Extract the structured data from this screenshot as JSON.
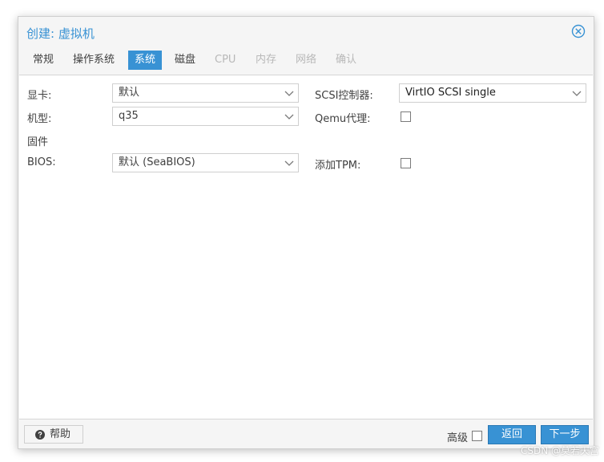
{
  "dialog": {
    "title": "创建: 虚拟机"
  },
  "tabs": [
    {
      "label": "常规",
      "state": "normal"
    },
    {
      "label": "操作系统",
      "state": "normal"
    },
    {
      "label": "系统",
      "state": "active"
    },
    {
      "label": "磁盘",
      "state": "normal"
    },
    {
      "label": "CPU",
      "state": "disabled"
    },
    {
      "label": "内存",
      "state": "disabled"
    },
    {
      "label": "网络",
      "state": "disabled"
    },
    {
      "label": "确认",
      "state": "disabled"
    }
  ],
  "form": {
    "graphics": {
      "label": "显卡:",
      "value": "默认"
    },
    "machine": {
      "label": "机型:",
      "value": "q35"
    },
    "firmware_heading": "固件",
    "bios": {
      "label": "BIOS:",
      "value": "默认 (SeaBIOS)"
    },
    "scsi": {
      "label": "SCSI控制器:",
      "value": "VirtIO SCSI single"
    },
    "qemu_agent": {
      "label": "Qemu代理:",
      "checked": false
    },
    "tpm": {
      "label": "添加TPM:",
      "checked": false
    }
  },
  "footer": {
    "help_label": "帮助",
    "advanced_label": "高级",
    "advanced_checked": false,
    "back_label": "返回",
    "next_label": "下一步"
  },
  "watermark": "CSDN @莫若天宫",
  "colors": {
    "accent": "#3892d4",
    "disabled_text": "#b8b8b8",
    "dialog_bg": "#f5f5f5"
  }
}
